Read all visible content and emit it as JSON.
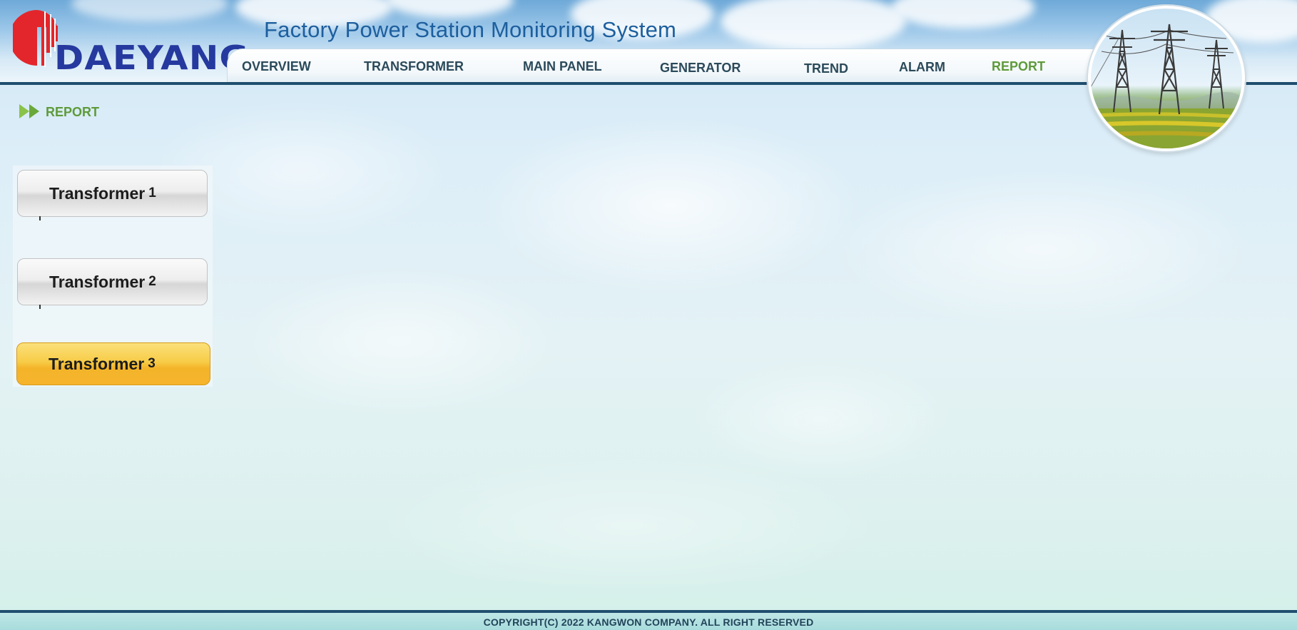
{
  "header": {
    "brand": "DAEYANG",
    "title": "Factory Power Station Monitoring System",
    "logo_icon": "red-sun-stripes-logo",
    "badge_icon": "power-tower-field-image"
  },
  "nav": {
    "items": [
      {
        "label": "OVERVIEW",
        "active": false
      },
      {
        "label": "TRANSFORMER",
        "active": false
      },
      {
        "label": "MAIN PANEL",
        "active": false
      },
      {
        "label": "GENERATOR",
        "active": false
      },
      {
        "label": "TREND",
        "active": false
      },
      {
        "label": "ALARM",
        "active": false
      },
      {
        "label": "REPORT",
        "active": true
      }
    ]
  },
  "section": {
    "label": "REPORT",
    "icon": "double-arrow-icon"
  },
  "sidebar": {
    "buttons": [
      {
        "label": "Transformer",
        "number": "1",
        "selected": false
      },
      {
        "label": "Transformer",
        "number": "2",
        "selected": false
      },
      {
        "label": "Transformer",
        "number": "3",
        "selected": true
      }
    ]
  },
  "footer": {
    "copyright": "COPYRIGHT(C) 2022 KANGWON COMPANY. ALL RIGHT RESERVED"
  },
  "colors": {
    "brand_blue": "#25399e",
    "logo_red": "#e3262b",
    "title_blue": "#1d5f9e",
    "active_green": "#5f9a3a",
    "selected_gold": "#f7cc47",
    "border_navy": "#1f4e6f"
  }
}
